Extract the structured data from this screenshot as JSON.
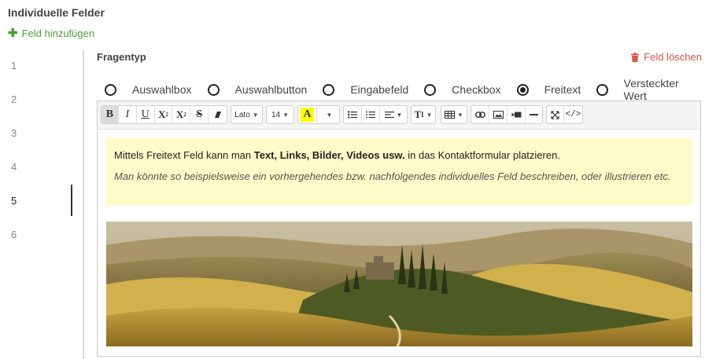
{
  "header": {
    "title": "Individuelle Felder"
  },
  "add_field": {
    "label": "Feld hinzufügen"
  },
  "field_numbers": [
    {
      "label": "1",
      "active": false
    },
    {
      "label": "2",
      "active": false
    },
    {
      "label": "3",
      "active": false
    },
    {
      "label": "4",
      "active": false
    },
    {
      "label": "5",
      "active": true
    },
    {
      "label": "6",
      "active": false
    }
  ],
  "question_type": {
    "label": "Fragentyp",
    "delete_label": "Feld löschen",
    "options": [
      {
        "label": "Auswahlbox",
        "checked": false
      },
      {
        "label": "Auswahlbutton",
        "checked": false
      },
      {
        "label": "Eingabefeld",
        "checked": false
      },
      {
        "label": "Checkbox",
        "checked": false
      },
      {
        "label": "Freitext",
        "checked": true
      },
      {
        "label": "Versteckter Wert",
        "checked": false
      }
    ]
  },
  "toolbar": {
    "font_name": "Lato",
    "font_size": "14",
    "icons": [
      "bold-icon",
      "italic-icon",
      "underline-icon",
      "superscript-icon",
      "subscript-icon",
      "strikethrough-icon",
      "eraser-icon",
      "text-color-icon",
      "unordered-list-icon",
      "ordered-list-icon",
      "align-icon",
      "line-height-icon",
      "table-icon",
      "link-icon",
      "picture-icon",
      "video-icon",
      "horizontal-rule-icon",
      "fullscreen-icon",
      "code-view-icon"
    ]
  },
  "content": {
    "intro": "Mittels Freitext Feld kann man ",
    "intro_bold": "Text, Links, Bilder, Videos usw.",
    "intro_end": " in das Kontaktformular platzieren.",
    "italic": "Man könnte so beispielsweise ein vorhergehendes bzw. nachfolgendes individuelles Feld beschreiben, oder illustrieren etc."
  },
  "colors": {
    "accent_green": "#4aa23a",
    "delete_red": "#d9534f",
    "note_background": "#fffbc8",
    "highlight_yellow": "#ffff00"
  }
}
